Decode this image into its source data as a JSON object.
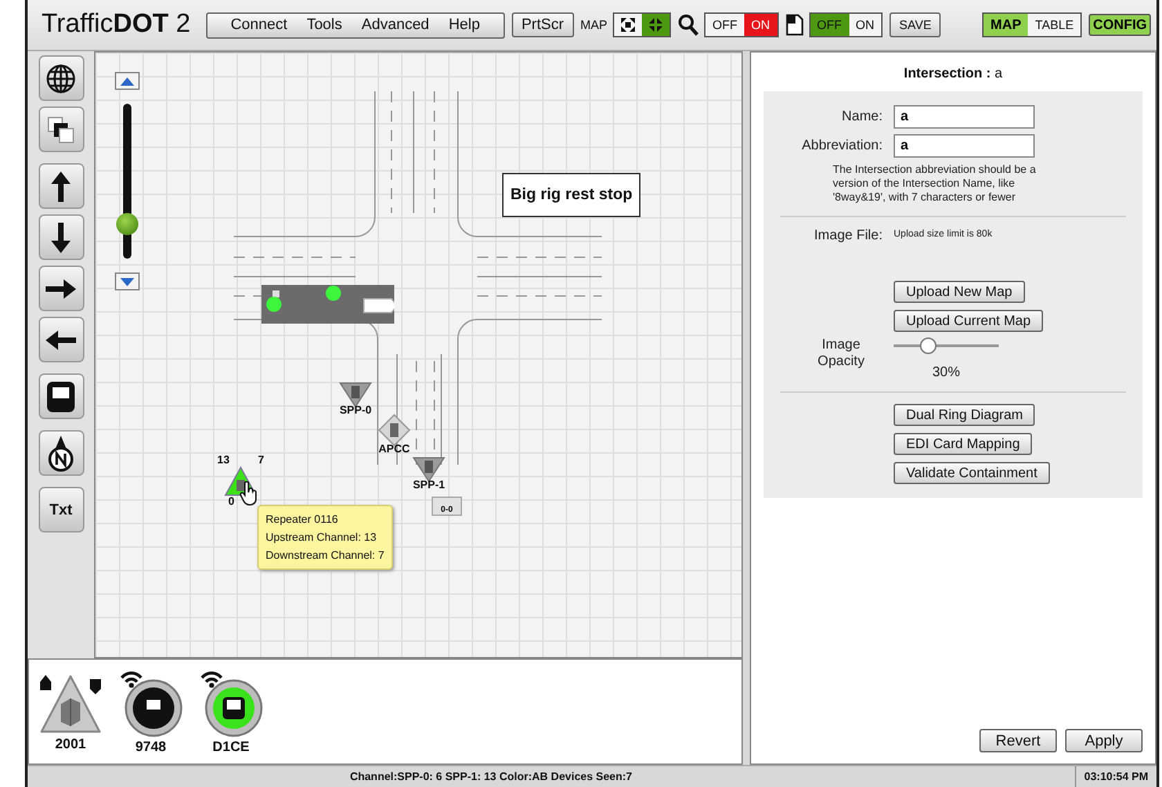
{
  "header": {
    "logo": "Traffic**DOT** 2",
    "menu": [
      "Connect",
      "Tools",
      "Advanced",
      "Help"
    ],
    "print_button": "PrtScr",
    "map_label": "MAP",
    "map_views": [
      {
        "kind": "expand",
        "selected": false
      },
      {
        "kind": "collapse",
        "selected": true
      }
    ],
    "toggles": [
      {
        "kind": "search",
        "color": "#e8141b",
        "options": [
          {
            "label": "OFF",
            "selected": false
          },
          {
            "label": "ON",
            "selected": true
          }
        ]
      },
      {
        "kind": "document",
        "color": "#4d9a12",
        "options": [
          {
            "label": "OFF",
            "selected": true
          },
          {
            "label": "ON",
            "selected": false
          }
        ]
      }
    ],
    "save_button": "SAVE",
    "view_tabs": [
      {
        "label": "MAP",
        "selected": true
      },
      {
        "label": "TABLE",
        "selected": false
      }
    ],
    "config_button": "CONFIG"
  },
  "tools": [
    {
      "kind": "globe"
    },
    {
      "kind": "layers"
    },
    {
      "kind": "up"
    },
    {
      "kind": "down"
    },
    {
      "kind": "right"
    },
    {
      "kind": "left"
    },
    {
      "kind": "device"
    },
    {
      "kind": "compass"
    },
    {
      "kind": "text",
      "label": "Txt"
    }
  ],
  "zoom": {
    "level": 0.2
  },
  "map": {
    "items": [
      {
        "kind": "note",
        "text": "Big rig rest stop"
      },
      {
        "kind": "phase_bar"
      },
      {
        "kind": "detector",
        "label": "SPP-0"
      },
      {
        "kind": "cabinet",
        "label": "APCC"
      },
      {
        "kind": "repeater",
        "upstream": "13",
        "downstream": "7",
        "label": "0"
      },
      {
        "kind": "detector",
        "label": "SPP-1",
        "sublabel": "0-0"
      }
    ],
    "tooltip": [
      "Repeater 0116",
      "Upstream Channel: 13",
      "Downstream Channel: 7"
    ]
  },
  "tray": [
    {
      "kind": "repeater",
      "label": "2001"
    },
    {
      "kind": "sensor",
      "label": "9748"
    },
    {
      "kind": "gateway",
      "label": "D1CE"
    }
  ],
  "panel": {
    "title": "**Intersection :** a",
    "fields": [
      {
        "label": "Name:",
        "value": "a"
      },
      {
        "label": "Abbreviation:",
        "value": "a"
      }
    ],
    "help": "The Intersection abbreviation should be a version of the Intersection Name, like '8way&19', with 7 characters or fewer",
    "image_file_label": "Image File:",
    "upload_note": "Upload size limit is 80k",
    "upload_buttons": [
      "Upload New Map",
      "Upload Current Map"
    ],
    "opacity": {
      "label": "Image Opacity",
      "level": 0.3,
      "reading": "30%"
    },
    "tool_buttons": [
      "Dual Ring Diagram",
      "EDI Card Mapping",
      "Validate Containment"
    ],
    "actions": [
      "Revert",
      "Apply"
    ]
  },
  "status": {
    "text": "Channel:SPP-0: 6 SPP-1: 13 Color:AB Devices Seen:7",
    "time": "03:10:54 PM"
  }
}
